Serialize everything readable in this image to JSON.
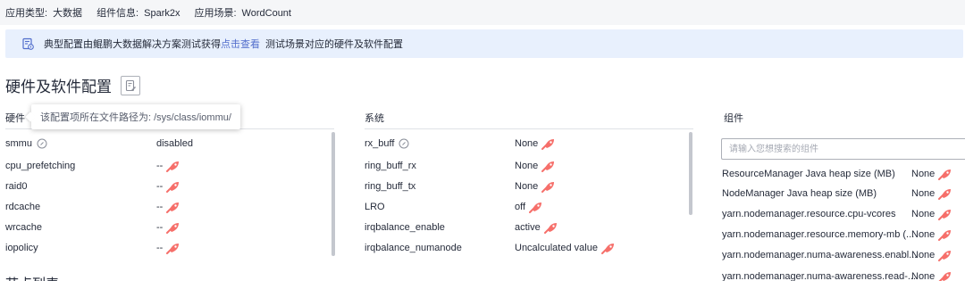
{
  "meta": {
    "type_label": "应用类型:",
    "type_value": "大数据",
    "component_label": "组件信息:",
    "component_value": "Spark2x",
    "scenario_label": "应用场景:",
    "scenario_value": "WordCount"
  },
  "notice": {
    "text_before": "典型配置由鲲鹏大数据解决方案测试获得",
    "link": "点击查看",
    "text_after": "测试场景对应的硬件及软件配置"
  },
  "section_title": "硬件及软件配置",
  "tooltip": "该配置项所在文件路径为: /sys/class/iommu/",
  "columns": {
    "hardware": "硬件",
    "system": "系统",
    "components": "组件"
  },
  "hardware": [
    {
      "name": "smmu",
      "value": "disabled"
    },
    {
      "name": "cpu_prefetching",
      "value": "--"
    },
    {
      "name": "raid0",
      "value": "--"
    },
    {
      "name": "rdcache",
      "value": "--"
    },
    {
      "name": "wrcache",
      "value": "--"
    },
    {
      "name": "iopolicy",
      "value": "--"
    }
  ],
  "system": [
    {
      "name": "rx_buff",
      "value": "None"
    },
    {
      "name": "ring_buff_rx",
      "value": "None"
    },
    {
      "name": "ring_buff_tx",
      "value": "None"
    },
    {
      "name": "LRO",
      "value": "off"
    },
    {
      "name": "irqbalance_enable",
      "value": "active"
    },
    {
      "name": "irqbalance_numanode",
      "value": "Uncalculated value"
    }
  ],
  "search": {
    "placeholder": "请输入您想搜索的组件"
  },
  "components": [
    {
      "name": "ResourceManager Java heap size (MB)",
      "value": "None"
    },
    {
      "name": "NodeManager Java heap size (MB)",
      "value": "None"
    },
    {
      "name": "yarn.nodemanager.resource.cpu-vcores",
      "value": "None"
    },
    {
      "name": "yarn.nodemanager.resource.memory-mb (...",
      "value": "None"
    },
    {
      "name": "yarn.nodemanager.numa-awareness.enabl...",
      "value": "None"
    },
    {
      "name": "yarn.nodemanager.numa-awareness.read-...",
      "value": "None"
    }
  ],
  "bottom_title": "节点列表",
  "colors": {
    "accent": "#526ecc",
    "rocket": "#f66f6a",
    "notice_bg": "#e8f0fd"
  }
}
